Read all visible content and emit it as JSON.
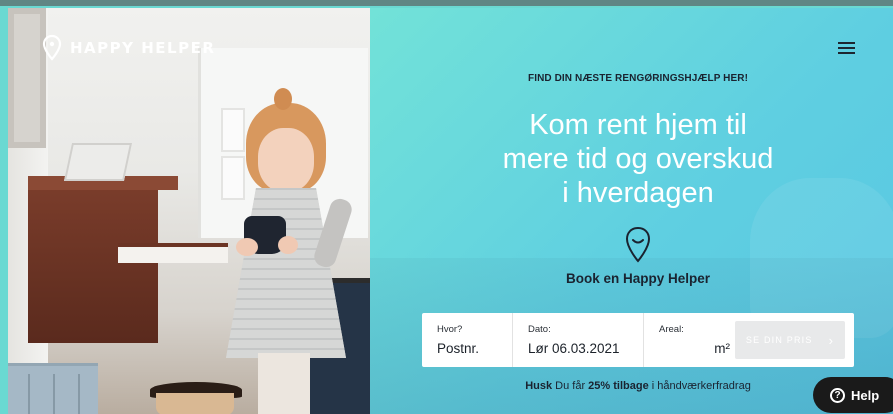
{
  "brand": {
    "name": "HAPPY HELPER"
  },
  "hero": {
    "tagline": "FIND DIN NÆSTE RENGØRINGSHJÆLP HER!",
    "headline_lines": [
      "Kom rent hjem til",
      "mere tid og overskud",
      "i hverdagen"
    ],
    "book_text": "Book en Happy Helper"
  },
  "form": {
    "where_label": "Hvor?",
    "where_value": "Postnr.",
    "date_label": "Dato:",
    "date_value": "Lør 06.03.2021",
    "area_label": "Areal:",
    "area_value": "m²",
    "submit_label": "SE DIN PRIS",
    "submit_chevron": "›"
  },
  "note": {
    "prefix": "Husk",
    "middle": " Du får ",
    "highlight": "25% tilbage",
    "suffix": " i håndværkerfradrag"
  },
  "help": {
    "label": "Help",
    "icon": "?"
  },
  "icons": {
    "logo": "map-pin-icon",
    "menu": "hamburger-menu-icon",
    "pin": "smiling-pin-icon",
    "help": "question-circle-icon"
  },
  "colors": {
    "teal": "#6ad9d2",
    "dark_text": "#1a2330",
    "cta_disabled": "#e8e9ea",
    "help_bg": "#1a1a1a"
  }
}
